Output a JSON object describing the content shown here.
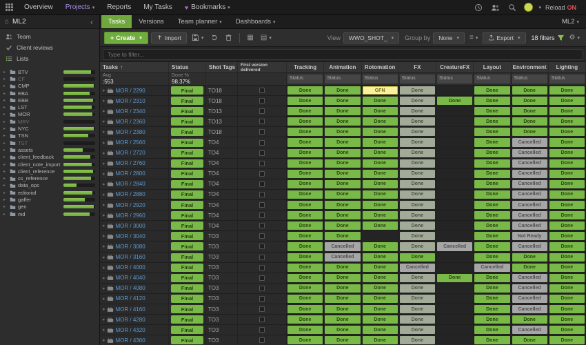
{
  "topnav": {
    "items": [
      {
        "label": "Overview",
        "active": false,
        "caret": false,
        "heart": false
      },
      {
        "label": "Projects",
        "active": true,
        "caret": true,
        "heart": false
      },
      {
        "label": "Reports",
        "active": false,
        "caret": false,
        "heart": false
      },
      {
        "label": "My Tasks",
        "active": false,
        "caret": false,
        "heart": false
      },
      {
        "label": "Bookmarks",
        "active": false,
        "caret": true,
        "heart": true
      }
    ],
    "reload_label": "Reload",
    "reload_state": "ON"
  },
  "sidebar": {
    "project": "ML2",
    "items": [
      {
        "label": "Team",
        "icon": "team"
      },
      {
        "label": "Client reviews",
        "icon": "check"
      },
      {
        "label": "Lists",
        "icon": "list"
      }
    ],
    "tree": [
      {
        "name": "BTV",
        "progress": 88,
        "dim": false
      },
      {
        "name": "CF",
        "progress": 0,
        "dim": true
      },
      {
        "name": "CMP",
        "progress": 96,
        "dim": false
      },
      {
        "name": "EBA",
        "progress": 82,
        "dim": false
      },
      {
        "name": "EBB",
        "progress": 93,
        "dim": false
      },
      {
        "name": "LST",
        "progress": 90,
        "dim": false
      },
      {
        "name": "MOR",
        "progress": 92,
        "dim": false
      },
      {
        "name": "MRV",
        "progress": 0,
        "dim": true
      },
      {
        "name": "NYC",
        "progress": 95,
        "dim": false
      },
      {
        "name": "TSN",
        "progress": 78,
        "dim": false
      },
      {
        "name": "TST",
        "progress": 0,
        "dim": true
      },
      {
        "name": "assets",
        "progress": 60,
        "dim": false
      },
      {
        "name": "client_feedback",
        "progress": 85,
        "dim": false
      },
      {
        "name": "client_note_import",
        "progress": 90,
        "dim": false
      },
      {
        "name": "client_reference",
        "progress": 94,
        "dim": false
      },
      {
        "name": "cs_reference",
        "progress": 88,
        "dim": false
      },
      {
        "name": "data_ops",
        "progress": 42,
        "dim": false
      },
      {
        "name": "editorial",
        "progress": 92,
        "dim": false
      },
      {
        "name": "gaffer",
        "progress": 68,
        "dim": false
      },
      {
        "name": "gen",
        "progress": 95,
        "dim": false
      },
      {
        "name": "md",
        "progress": 82,
        "dim": false
      }
    ]
  },
  "tabs": {
    "items": [
      {
        "label": "Tasks",
        "active": true,
        "caret": false
      },
      {
        "label": "Versions",
        "active": false,
        "caret": false
      },
      {
        "label": "Team planner",
        "active": false,
        "caret": true
      },
      {
        "label": "Dashboards",
        "active": false,
        "caret": true
      }
    ],
    "right_label": "ML2"
  },
  "toolbar": {
    "create_label": "Create",
    "import_label": "Import",
    "view_label": "View",
    "view_value": "WWO_SHOT_",
    "groupby_label": "Group by",
    "groupby_value": "None",
    "export_label": "Export",
    "filters_label": "18 filters"
  },
  "filter": {
    "placeholder": "Type to filter..."
  },
  "colors": {
    "accent_green": "#6fae3e",
    "link_blue": "#5b9bd5",
    "nav_active_purple": "#a98fe0",
    "reload_on_red": "#e05252"
  },
  "table": {
    "columns": [
      "Tasks",
      "Status",
      "Shot Tags",
      "First version delivered"
    ],
    "pipeline_columns": [
      "Tracking",
      "Animation",
      "Rotomation",
      "FX",
      "CreatureFX",
      "Layout",
      "Environment",
      "Lighting"
    ],
    "sub_label": "Status",
    "summary": {
      "tasks_label": "Avg",
      "tasks_value": ":553",
      "status_label": "Done %",
      "status_value": "98.37%"
    },
    "status_labels": {
      "done": "Done",
      "done_muted": "Done",
      "gfn": "GFN",
      "cancelled": "Cancelled",
      "notready": "Not Ready"
    },
    "status_colors": {
      "done": "#79b947",
      "done_muted": "#a2ab97",
      "gfn": "#f8f19e",
      "cancelled": "#a6a6a6",
      "notready": "#a6a6a6"
    },
    "rows": [
      {
        "name": "MOR / 2290",
        "status": "Final",
        "tags": "TO18",
        "cells": [
          "done",
          "done",
          "gfn",
          "done_muted",
          "",
          "done",
          "done",
          "done"
        ]
      },
      {
        "name": "MOR / 2310",
        "status": "Final",
        "tags": "TO18",
        "cells": [
          "done",
          "done",
          "done",
          "done_muted",
          "done",
          "done",
          "done",
          "done"
        ]
      },
      {
        "name": "MOR / 2340",
        "status": "Final",
        "tags": "TO13",
        "cells": [
          "done",
          "done",
          "done",
          "done_muted",
          "",
          "done",
          "done",
          "done"
        ]
      },
      {
        "name": "MOR / 2360",
        "status": "Final",
        "tags": "TO13",
        "cells": [
          "done",
          "done",
          "done",
          "done_muted",
          "",
          "done",
          "done",
          "done"
        ]
      },
      {
        "name": "MOR / 2380",
        "status": "Final",
        "tags": "TO18",
        "cells": [
          "done",
          "done",
          "done",
          "done_muted",
          "",
          "done",
          "done",
          "done"
        ]
      },
      {
        "name": "MOR / 2560",
        "status": "Final",
        "tags": "TO4",
        "cells": [
          "done",
          "done",
          "done",
          "done_muted",
          "",
          "done",
          "cancelled",
          "done"
        ]
      },
      {
        "name": "MOR / 2720",
        "status": "Final",
        "tags": "TO4",
        "cells": [
          "done",
          "done",
          "done",
          "done_muted",
          "",
          "done",
          "cancelled",
          "done"
        ]
      },
      {
        "name": "MOR / 2760",
        "status": "Final",
        "tags": "TO4",
        "cells": [
          "done",
          "done",
          "done",
          "done_muted",
          "",
          "done",
          "cancelled",
          "done"
        ]
      },
      {
        "name": "MOR / 2800",
        "status": "Final",
        "tags": "TO4",
        "cells": [
          "done",
          "done",
          "done",
          "done_muted",
          "",
          "done",
          "cancelled",
          "done"
        ]
      },
      {
        "name": "MOR / 2840",
        "status": "Final",
        "tags": "TO4",
        "cells": [
          "done",
          "done",
          "done",
          "done_muted",
          "",
          "done",
          "cancelled",
          "done"
        ]
      },
      {
        "name": "MOR / 2880",
        "status": "Final",
        "tags": "TO4",
        "cells": [
          "done",
          "done",
          "done",
          "done_muted",
          "",
          "done",
          "cancelled",
          "done"
        ]
      },
      {
        "name": "MOR / 2920",
        "status": "Final",
        "tags": "TO4",
        "cells": [
          "done",
          "done",
          "done",
          "done_muted",
          "",
          "done",
          "cancelled",
          "done"
        ]
      },
      {
        "name": "MOR / 2960",
        "status": "Final",
        "tags": "TO4",
        "cells": [
          "done",
          "done",
          "done",
          "done_muted",
          "",
          "done",
          "cancelled",
          "done"
        ]
      },
      {
        "name": "MOR / 3000",
        "status": "Final",
        "tags": "TO4",
        "cells": [
          "done",
          "done",
          "done",
          "done_muted",
          "",
          "done",
          "cancelled",
          "done"
        ]
      },
      {
        "name": "MOR / 3040",
        "status": "Final",
        "tags": "TO3",
        "cells": [
          "done",
          "done",
          "",
          "done_muted",
          "",
          "done",
          "notready",
          "done"
        ]
      },
      {
        "name": "MOR / 3080",
        "status": "Final",
        "tags": "TO3",
        "cells": [
          "done",
          "cancelled",
          "done",
          "done_muted",
          "cancelled",
          "done",
          "cancelled",
          "done"
        ]
      },
      {
        "name": "MOR / 3160",
        "status": "Final",
        "tags": "TO3",
        "cells": [
          "done",
          "cancelled",
          "done",
          "done",
          "",
          "done",
          "done",
          "done"
        ]
      },
      {
        "name": "MOR / 4000",
        "status": "Final",
        "tags": "TO3",
        "cells": [
          "done",
          "done",
          "done",
          "cancelled",
          "",
          "cancelled",
          "done",
          "done"
        ]
      },
      {
        "name": "MOR / 4040",
        "status": "Final",
        "tags": "TO3",
        "cells": [
          "done",
          "done",
          "done",
          "done_muted",
          "done",
          "done",
          "cancelled",
          "done"
        ]
      },
      {
        "name": "MOR / 4080",
        "status": "Final",
        "tags": "TO3",
        "cells": [
          "done",
          "done",
          "done",
          "done_muted",
          "",
          "done",
          "cancelled",
          "done"
        ]
      },
      {
        "name": "MOR / 4120",
        "status": "Final",
        "tags": "TO3",
        "cells": [
          "done",
          "done",
          "done",
          "done_muted",
          "",
          "done",
          "cancelled",
          "done"
        ]
      },
      {
        "name": "MOR / 4160",
        "status": "Final",
        "tags": "TO3",
        "cells": [
          "done",
          "done",
          "done",
          "done_muted",
          "",
          "done",
          "cancelled",
          "done"
        ]
      },
      {
        "name": "MOR / 4280",
        "status": "Final",
        "tags": "TO3",
        "cells": [
          "done",
          "done",
          "done",
          "done_muted",
          "",
          "done",
          "done",
          "done"
        ]
      },
      {
        "name": "MOR / 4320",
        "status": "Final",
        "tags": "TO3",
        "cells": [
          "done",
          "done",
          "done",
          "done_muted",
          "",
          "done",
          "cancelled",
          "done"
        ]
      },
      {
        "name": "MOR / 4360",
        "status": "Final",
        "tags": "TO3",
        "cells": [
          "done",
          "done",
          "done",
          "done_muted",
          "",
          "done",
          "done",
          "done"
        ]
      }
    ]
  }
}
